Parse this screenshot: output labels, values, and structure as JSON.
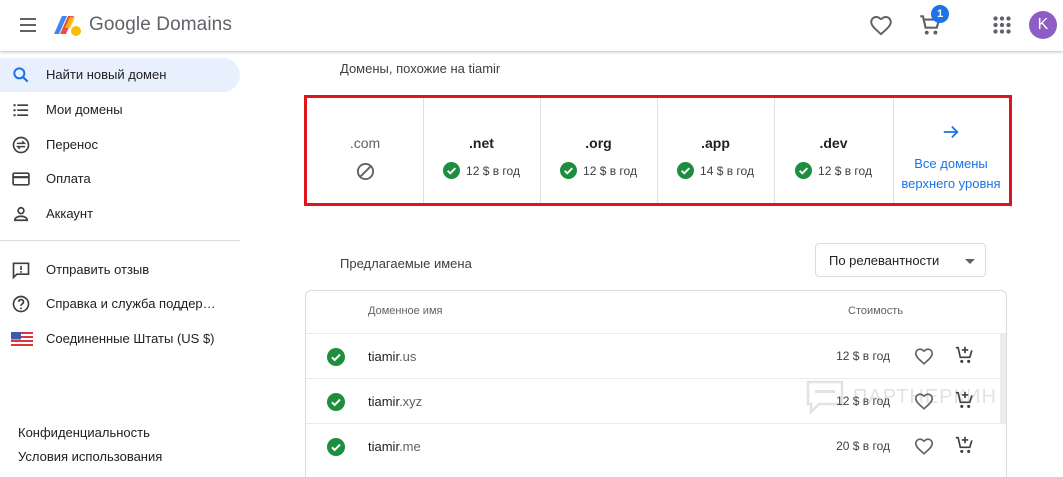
{
  "header": {
    "logo_text": "Google Domains",
    "cart_count": "1",
    "avatar_letter": "K",
    "avatar_color": "#8e5cc5"
  },
  "sidebar": {
    "items": [
      {
        "label": "Найти новый домен",
        "icon": "search-icon",
        "active": true
      },
      {
        "label": "Мои домены",
        "icon": "list-icon",
        "active": false
      },
      {
        "label": "Перенос",
        "icon": "transfer-icon",
        "active": false
      },
      {
        "label": "Оплата",
        "icon": "credit-card-icon",
        "active": false
      },
      {
        "label": "Аккаунт",
        "icon": "person-icon",
        "active": false
      }
    ],
    "secondary": [
      {
        "label": "Отправить отзыв",
        "icon": "feedback-icon"
      },
      {
        "label": "Справка и служба поддер…",
        "icon": "help-icon"
      },
      {
        "label": "Соединенные Штаты (US $)",
        "icon": "us-flag-icon"
      }
    ],
    "footer": [
      {
        "label": "Конфиденциальность"
      },
      {
        "label": "Условия использования"
      }
    ]
  },
  "similar": {
    "title": "Домены, похожие на tiamir",
    "tlds": [
      {
        "name": ".com",
        "available": false,
        "price": ""
      },
      {
        "name": ".net",
        "available": true,
        "price": "12 $ в год"
      },
      {
        "name": ".org",
        "available": true,
        "price": "12 $ в год"
      },
      {
        "name": ".app",
        "available": true,
        "price": "14 $ в год"
      },
      {
        "name": ".dev",
        "available": true,
        "price": "12 $ в год"
      }
    ],
    "all_tlds_line1": "Все домены",
    "all_tlds_line2": "верхнего уровня"
  },
  "suggested": {
    "title": "Предлагаемые имена",
    "sort_value": "По релевантности",
    "columns": {
      "domain": "Доменное имя",
      "price": "Стоимость"
    },
    "rows": [
      {
        "base": "tiamir",
        "tld": ".us",
        "price": "12 $ в год"
      },
      {
        "base": "tiamir",
        "tld": ".xyz",
        "price": "12 $ в год"
      },
      {
        "base": "tiamir",
        "tld": ".me",
        "price": "20 $ в год"
      }
    ]
  },
  "watermark": {
    "text": "ПАРТНЕРКИН"
  },
  "colors": {
    "accent": "#1a73e8",
    "success": "#1e8e3e",
    "highlight_border": "#e0151b",
    "active_nav": "#e8f0fe"
  }
}
